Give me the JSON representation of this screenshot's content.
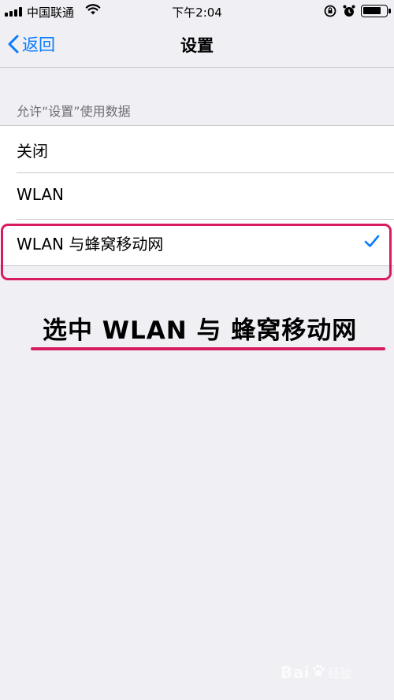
{
  "status_bar": {
    "carrier": "中国联通",
    "time": "下午2:04",
    "icons": [
      "signal-icon",
      "wifi-icon",
      "rotation-lock-icon",
      "alarm-icon",
      "battery-icon"
    ]
  },
  "nav": {
    "back_label": "返回",
    "title": "设置"
  },
  "section": {
    "header": "允许“设置”使用数据",
    "options": [
      {
        "label": "关闭",
        "selected": false
      },
      {
        "label": "WLAN",
        "selected": false
      },
      {
        "label": "WLAN 与蜂窝移动网",
        "selected": true
      }
    ]
  },
  "annotation": {
    "caption": "选中 WLAN 与 蜂窝移动网",
    "color": "#d81b60"
  },
  "watermark": {
    "text": "Bai",
    "sub": "经验"
  },
  "colors": {
    "accent": "#0a7aff",
    "background": "#efeff4"
  }
}
